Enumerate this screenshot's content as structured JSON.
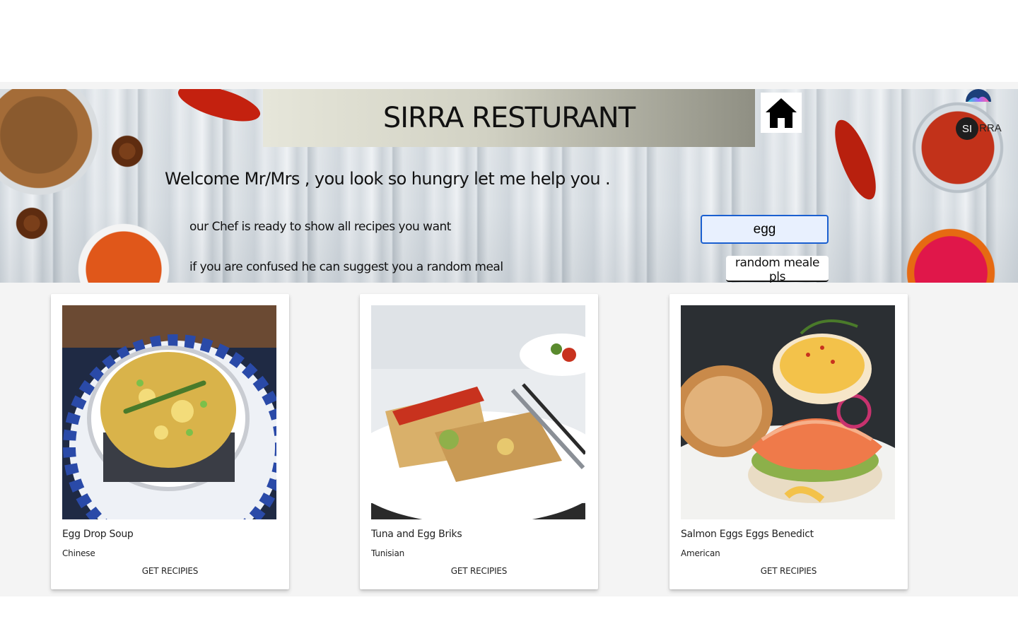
{
  "header": {
    "title": "SIRRA RESTURANT",
    "home_icon": "home-icon",
    "logo": {
      "badge": "SI",
      "rest": "RRA"
    }
  },
  "hero": {
    "welcome": "Welcome Mr/Mrs , you look so hungry let me help you .",
    "chef_line": "our Chef is ready to show all recipes you want",
    "random_line": "if you are confused he can suggest you a random meal",
    "search_value": "egg",
    "random_button": "random meale pls"
  },
  "cards": [
    {
      "name": "Egg Drop Soup",
      "area": "Chinese",
      "button": "GET RECIPIES"
    },
    {
      "name": "Tuna and Egg Briks",
      "area": "Tunisian",
      "button": "GET RECIPIES"
    },
    {
      "name": "Salmon Eggs Eggs Benedict",
      "area": "American",
      "button": "GET RECIPIES"
    }
  ],
  "colors": {
    "accent": "#1a5fd0",
    "page_bg": "#f4f4f4",
    "card_bg": "#ffffff"
  }
}
